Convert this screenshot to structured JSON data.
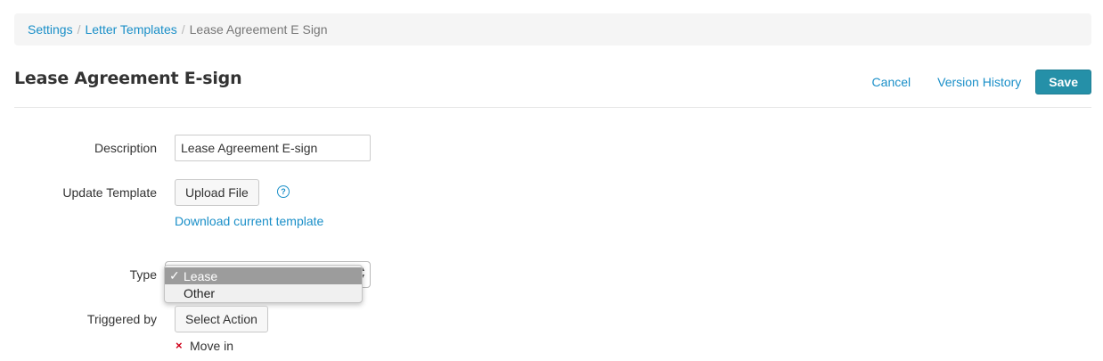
{
  "breadcrumb": {
    "items": [
      "Settings",
      "Letter Templates"
    ],
    "current": "Lease Agreement E Sign",
    "separator": "/"
  },
  "page": {
    "title": "Lease Agreement E-sign"
  },
  "actions": {
    "cancel": "Cancel",
    "version_history": "Version History",
    "save": "Save"
  },
  "form": {
    "description": {
      "label": "Description",
      "value": "Lease Agreement E-sign"
    },
    "update_template": {
      "label": "Update Template",
      "upload_button": "Upload File",
      "help_icon": "?",
      "download_link": "Download current template"
    },
    "type": {
      "label": "Type",
      "options": [
        "Lease",
        "Other"
      ],
      "selected": "Lease",
      "check_mark": "✓"
    },
    "triggered_by": {
      "label": "Triggered by",
      "select_button": "Select Action",
      "tags": [
        {
          "label": "Move in",
          "remove_icon": "×"
        }
      ]
    }
  },
  "colors": {
    "link": "#1a8fc8",
    "primary": "#2590a8",
    "remove": "#d0021b"
  }
}
